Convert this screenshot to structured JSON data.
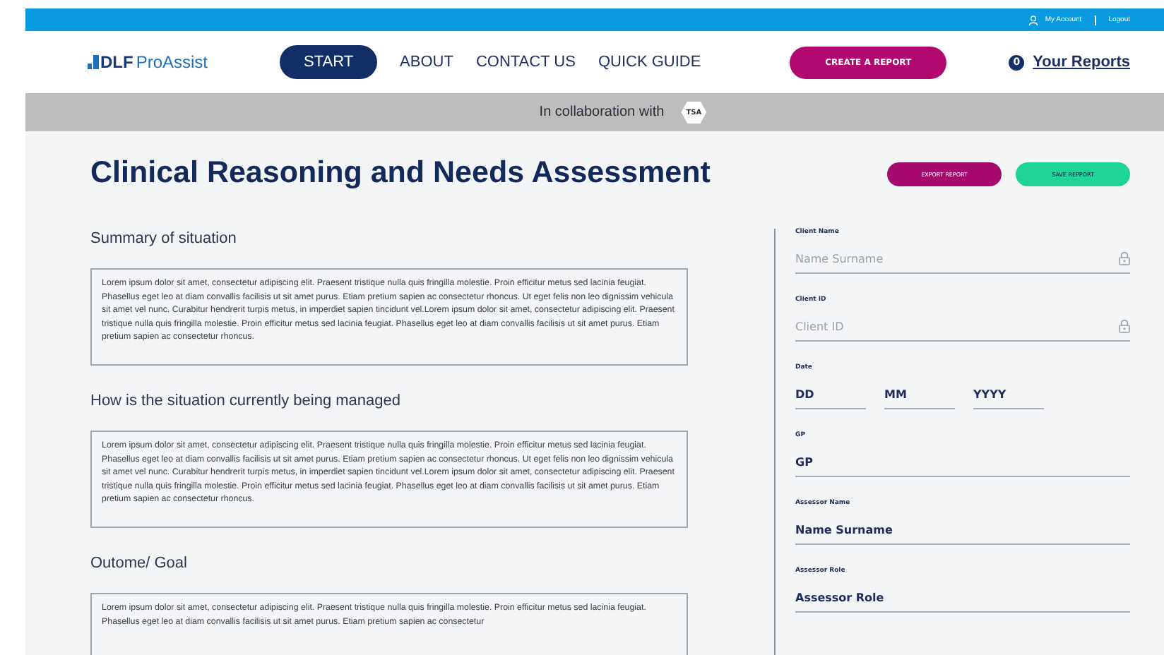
{
  "top_bar": {
    "links": [
      {
        "label": "My Account",
        "kind": "account"
      },
      {
        "label": "Logout",
        "kind": "logout"
      }
    ]
  },
  "nav": {
    "logo": {
      "bold": "DLF",
      "light": "ProAssist"
    },
    "items": [
      {
        "label": "START",
        "selected": true
      },
      {
        "label": "ABOUT",
        "selected": false
      },
      {
        "label": "CONTACT US",
        "selected": false
      },
      {
        "label": "QUICK GUIDE",
        "selected": false
      }
    ],
    "create_button": "CREATE A REPORT",
    "reports": {
      "count": "0",
      "label": "Your Reports"
    }
  },
  "collab": {
    "text": "In collaboration with",
    "badge": "TSA"
  },
  "page": {
    "title": "Clinical Reasoning and Needs Assessment",
    "actions": [
      {
        "label": "EXPORT REPORT",
        "kind": "export"
      },
      {
        "label": "SAVE REPPORT",
        "kind": "save"
      }
    ],
    "sections": [
      {
        "heading": "Summary of situation",
        "text": "Lorem ipsum dolor sit amet, consectetur adipiscing elit. Praesent tristique nulla quis fringilla molestie. Proin efficitur metus sed lacinia feugiat. Phasellus eget leo at diam convallis facilisis ut sit amet purus. Etiam pretium sapien ac consectetur rhoncus. Ut eget felis non leo dignissim vehicula sit amet vel nunc. Curabitur hendrerit turpis metus, in imperdiet sapien tincidunt vel.Lorem ipsum dolor sit amet, consectetur adipiscing elit. Praesent tristique nulla quis fringilla molestie. Proin efficitur metus sed lacinia feugiat. Phasellus eget leo at diam convallis facilisis ut sit amet purus. Etiam pretium sapien ac consectetur rhoncus."
      },
      {
        "heading": "How is the situation currently being managed",
        "text": "Lorem ipsum dolor sit amet, consectetur adipiscing elit. Praesent tristique nulla quis fringilla molestie. Proin efficitur metus sed lacinia feugiat. Phasellus eget leo at diam convallis facilisis ut sit amet purus. Etiam pretium sapien ac consectetur rhoncus. Ut eget felis non leo dignissim vehicula sit amet vel nunc. Curabitur hendrerit turpis metus, in imperdiet sapien tincidunt vel.Lorem ipsum dolor sit amet, consectetur adipiscing elit. Praesent tristique nulla quis fringilla molestie. Proin efficitur metus sed lacinia feugiat. Phasellus eget leo at diam convallis facilisis ut sit amet purus. Etiam pretium sapien ac consectetur rhoncus."
      },
      {
        "heading": "Outome/ Goal",
        "text": "Lorem ipsum dolor sit amet, consectetur adipiscing elit. Praesent tristique nulla quis fringilla molestie. Proin efficitur metus sed lacinia feugiat. Phasellus eget leo at diam convallis facilisis ut sit amet purus. Etiam pretium sapien ac consectetur"
      }
    ],
    "fields": [
      {
        "label": "Client Name",
        "kind": "text",
        "placeholder": "Name Surname",
        "locked": true
      },
      {
        "label": "Client ID",
        "kind": "text",
        "placeholder": "Client ID",
        "locked": true
      },
      {
        "label": "Date",
        "kind": "date",
        "parts": [
          "DD",
          "MM",
          "YYYY"
        ]
      },
      {
        "label": "GP",
        "kind": "text",
        "value": "GP",
        "locked": false
      },
      {
        "label": "Assessor Name",
        "kind": "text",
        "value": "Name Surname",
        "locked": false
      },
      {
        "label": "Assessor Role",
        "kind": "text",
        "value": "Assessor Role",
        "locked": false
      }
    ]
  }
}
